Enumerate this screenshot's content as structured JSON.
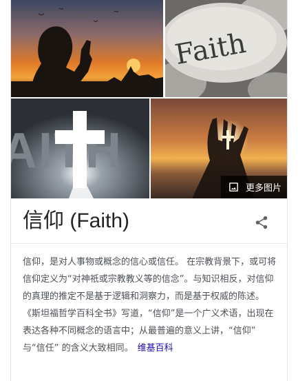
{
  "images": [
    {
      "icon": "praying-silhouette-image"
    },
    {
      "icon": "faith-stone-image",
      "text": "Faith"
    },
    {
      "icon": "faith-cross-image",
      "text": "AITH"
    },
    {
      "icon": "hands-cross-sunset-image"
    }
  ],
  "more_images": {
    "label": "更多图片",
    "icon": "image-icon"
  },
  "entity": {
    "title": "信仰 (Faith)",
    "share_icon": "share-icon"
  },
  "description": {
    "text": "信仰，是对人事物或概念的信心或信任。 在宗教背景下，或可将信仰定义为“对神祇或宗教教义等的信念”。与知识相反，对信仰的真理的推定不是基于逻辑和洞察力，而是基于权威的陈述。 《斯坦福哲学百科全书》写道，“信仰”是一个广义术语，出现在表达各种不同概念的语言中；从最普遍的意义上讲，“信仰” 与“信任” 的含义大致相同。",
    "source_link": "维基百科"
  },
  "colors": {
    "link": "#1a0dab",
    "title": "#222222",
    "body_text": "#4d5156"
  }
}
